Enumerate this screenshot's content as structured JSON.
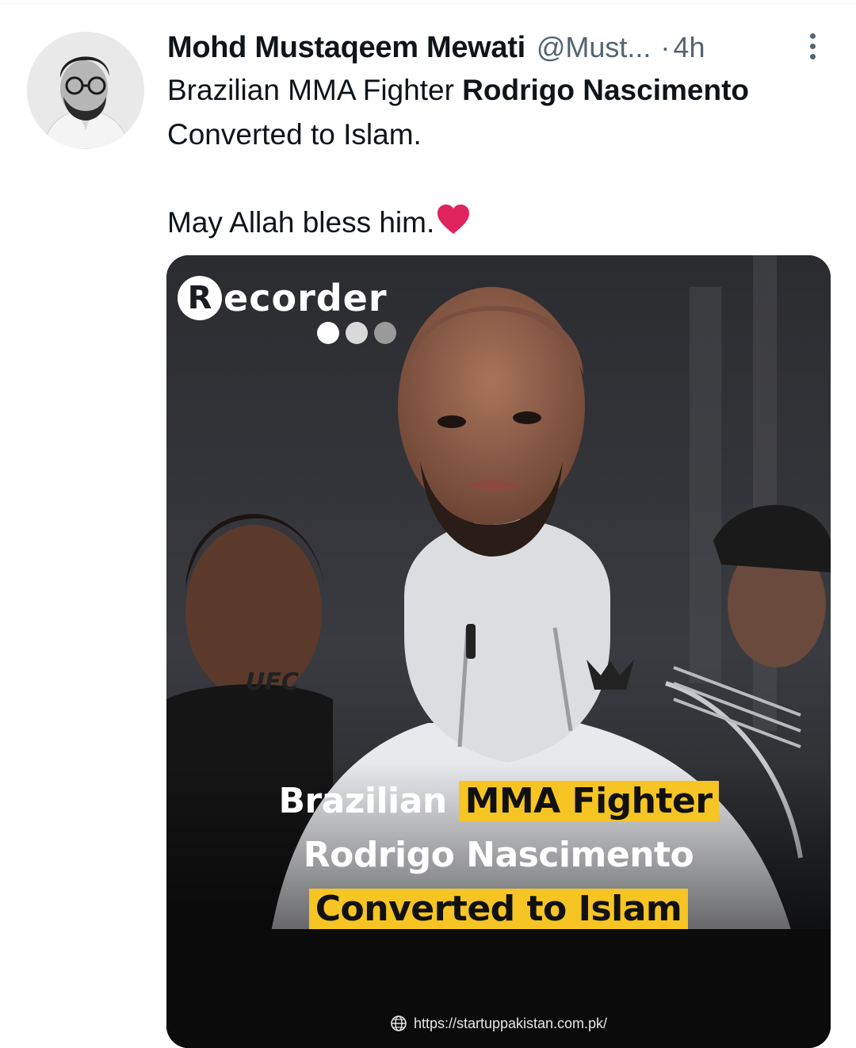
{
  "tweet": {
    "author_name": "Mohd Mustaqeem Mewati",
    "handle": "@Must...",
    "separator": "·",
    "time": "4h",
    "text_line1_pre": "Brazilian MMA Fighter ",
    "text_line1_bold": "Rodrigo Nascimento",
    "text_line2": "Converted to Islam.",
    "text_line3": "May Allah bless him.",
    "emoji": "red-heart-icon"
  },
  "media": {
    "brand": {
      "initial": "R",
      "rest": "ecorder",
      "dot_colors": [
        "#ffffff",
        "#d9d9d9",
        "#9a9a9a"
      ]
    },
    "headline": {
      "word1": "Brazilian",
      "highlight1": "MMA Fighter",
      "line2": "Rodrigo Nascimento",
      "highlight2": "Converted to Islam"
    },
    "hoodie_text": "UFC",
    "url": "https://startuppakistan.com.pk/"
  },
  "colors": {
    "text_primary": "#0f1419",
    "text_secondary": "#536471",
    "highlight": "#f6c523",
    "heart": "#e0245e"
  }
}
